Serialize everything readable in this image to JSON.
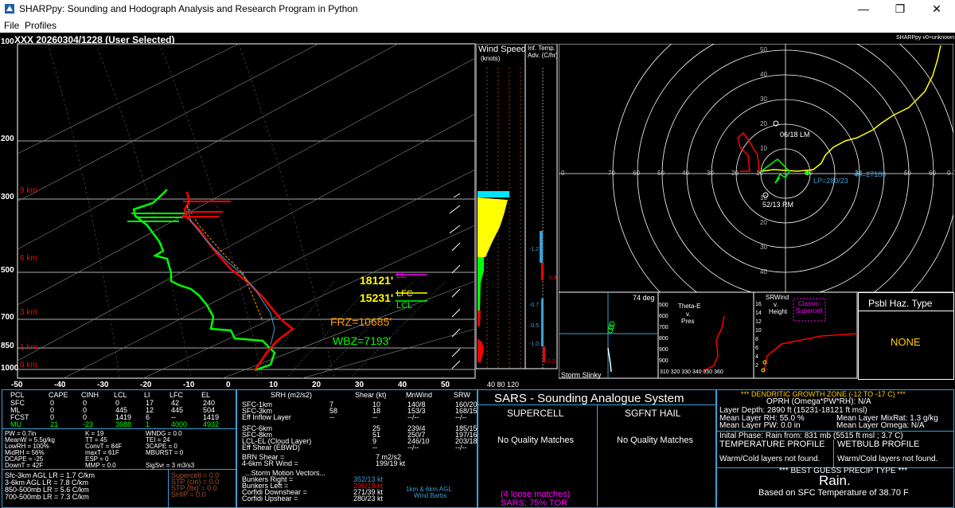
{
  "window": {
    "title": "SHARPpy: Sounding and Hodograph Analysis and Research Program in Python",
    "min": "—",
    "max": "❐",
    "close": "✕"
  },
  "menu": {
    "file": "File",
    "profiles": "Profiles"
  },
  "header": {
    "title": "XXX   20260304/1228  (User Selected)",
    "version": "SHARPpy v0+unknown"
  },
  "skewt": {
    "pressure_labels": [
      "100",
      "200",
      "300",
      "500",
      "700",
      "850",
      "1000"
    ],
    "height_labels": [
      "9 km",
      "6 km",
      "3 km",
      "1 km",
      "0 km"
    ],
    "temp_labels": [
      "-50",
      "-40",
      "-30",
      "-20",
      "-10",
      "0",
      "10",
      "20",
      "30",
      "40",
      "50"
    ],
    "el": "18121'",
    "el_tag": "EL",
    "lfc": "15231'",
    "lfc_tag": "LFC",
    "lcl_tag": "LCL",
    "frz": "FRZ=10685'",
    "wbz": "WBZ=7193'"
  },
  "panels": {
    "wind_speed": "Wind Speed",
    "wind_speed_sub": "(knots)",
    "inf_temp": "Inf. Temp.",
    "inf_temp_sub": "Adv. (C/hr)",
    "ws_ticks": "40  80 120",
    "inf_vals": [
      "-1.2",
      "0.4",
      "-0.7",
      "-0.5",
      "-1.0",
      "0.2"
    ]
  },
  "hodo": {
    "rings_up": [
      "50",
      "40",
      "30",
      "20",
      "10"
    ],
    "rings_down": [
      "10",
      "20",
      "30",
      "40",
      "50"
    ],
    "x_left": [
      "70",
      "60",
      "50",
      "40",
      "30",
      "20",
      "10"
    ],
    "x_right": [
      "10",
      "30",
      "50",
      "60",
      "70"
    ],
    "zero": "0",
    "zero_r": "0",
    "motion1": "06/18 LM",
    "motion2": "52/13 RM",
    "lp": "LP=280/23",
    "sm": "40=27180"
  },
  "mini": {
    "deg": "74 deg",
    "theta": "Theta-E",
    "theta_v": "v.",
    "theta_p": "Pres",
    "srwind": "SRWind",
    "srwind_v": "v.",
    "srwind_h": "Height",
    "classic": "Classic",
    "supercell": "Supercell",
    "slinky": "Storm Slinky",
    "p_labels": [
      "500",
      "600",
      "700",
      "800",
      "900",
      "900"
    ],
    "th_labels": "310  320  330  340  350  360",
    "sr_labels": [
      "16",
      "14",
      "12",
      "10",
      "8",
      "6",
      "4",
      "2"
    ]
  },
  "haz": {
    "title": "Psbl Haz. Type",
    "value": "NONE"
  },
  "parcels": {
    "headers": [
      "PCL",
      "CAPE",
      "CINH",
      "LCL",
      "LI",
      "LFC",
      "EL"
    ],
    "rows": [
      [
        "SFC",
        "0",
        "0",
        "0",
        "17",
        "42",
        "240"
      ],
      [
        "ML",
        "0",
        "0",
        "445",
        "12",
        "445",
        "504"
      ],
      [
        "FCST",
        "0",
        "0",
        "1419",
        "6",
        "--",
        "1419"
      ],
      [
        "MU",
        "21",
        "-23",
        "3688",
        "1",
        "4000",
        "4932"
      ]
    ]
  },
  "indices": {
    "c1": [
      "PW = 0.7in",
      "MeanW = 5.5g/kg",
      "LowRH = 100%",
      "MidRH = 56%",
      "DCAPE = -25",
      "DownT = 42F"
    ],
    "c2": [
      "K = 19",
      "TT = 45",
      "ConvT = 84F",
      "maxT = 61F",
      "ESP = 0",
      "MMP = 0.0"
    ],
    "c3": [
      "WNDG = 0.0",
      "TEI = 24",
      "3CAPE = 0",
      "MBURST = 0",
      "",
      "SigSvr = 3 m3/s3"
    ]
  },
  "lapse": [
    "Sfc-3km AGL LR = 1.7 C/km",
    "3-6km AGL LR = 7.8 C/km",
    "850-500mb LR = 5.6 C/km",
    "700-500mb LR = 7.3 C/km"
  ],
  "composites": [
    "Supercell = 0.0",
    "STP (cin) = 0.0",
    "STP (fix) = 0.0",
    "SHIP = 0.0"
  ],
  "kin": {
    "headers": [
      "SRH (m2/s2)",
      "Shear (kt)",
      "MnWind",
      "SRW"
    ],
    "rows": [
      [
        "SFC-1km",
        "7",
        "10",
        "140/8",
        "160/20"
      ],
      [
        "SFC-3km",
        "58",
        "18",
        "153/3",
        "168/15"
      ],
      [
        "Eff Inflow Layer",
        "--",
        "--",
        "--/--",
        "--/--"
      ],
      [
        "SFC-6km",
        "",
        "25",
        "239/4",
        "185/15"
      ],
      [
        "SFC-8km",
        "",
        "51",
        "250/7",
        "197/16"
      ],
      [
        "LCL-EL (Cloud Layer)",
        "",
        "9",
        "246/10",
        "203/18"
      ],
      [
        "Eff Shear (EBWD)",
        "",
        "--",
        "--/--",
        "--/--"
      ]
    ],
    "brn": "BRN Shear =",
    "brn_v": "7 m2/s2",
    "sr46": "4-6km SR Wind =",
    "sr46_v": "199/19 kt",
    "smv": "...Storm Motion Vectors...",
    "br": "Bunkers Right =",
    "br_v": "352/13 kt",
    "bl": "Bunkers Left =",
    "bl_v": "206/18 kt",
    "cd": "Corfidi Downshear =",
    "cd_v": "271/39 kt",
    "cu": "Corfidi Upshear =",
    "cu_v": "280/23 kt",
    "barbs": "1km & 6km AGL",
    "barbs2": "Wind Barbs"
  },
  "sars": {
    "title": "SARS - Sounding Analogue System",
    "supercell": "SUPERCELL",
    "hail": "SGFNT HAIL",
    "nq1": "No Quality Matches",
    "nq2": "No Quality Matches",
    "loose": "(4 loose matches)",
    "tor": "SARS: 75% TOR"
  },
  "dgz": {
    "title": "*** DENDRITIC GROWTH ZONE (-12 TO -17 C) ***",
    "oprh": "OPRH (Omega*PW*RH): N/A",
    "depth": "Layer Depth: 2890 ft (15231-18121 ft msl)",
    "rh": "Mean Layer RH: 55.0 %",
    "mixr": "Mean Layer MixRat: 1.3 g/kg",
    "pw": "Mean Layer PW: 0.0 in",
    "omega": "Mean Layer Omega: N/A"
  },
  "precip": {
    "phase": "Inital Phase: Rain from: 831 mb (5515 ft msl ; 3.7 C)",
    "temp_prof": "TEMPERATURE PROFILE",
    "wet_prof": "WETBULB PROFILE",
    "temp_txt": "Warm/Cold layers not found.",
    "wet_txt": "Warm/Cold layers not found.",
    "best": "*** BEST GUESS PRECIP TYPE ***",
    "type": "Rain.",
    "basis": "Based on SFC Temperature of 38.70 F"
  },
  "colors": {
    "temp": "#ff0000",
    "dew": "#00ff00",
    "hodo": "#ffff00",
    "accent": "#3aa0d8"
  }
}
